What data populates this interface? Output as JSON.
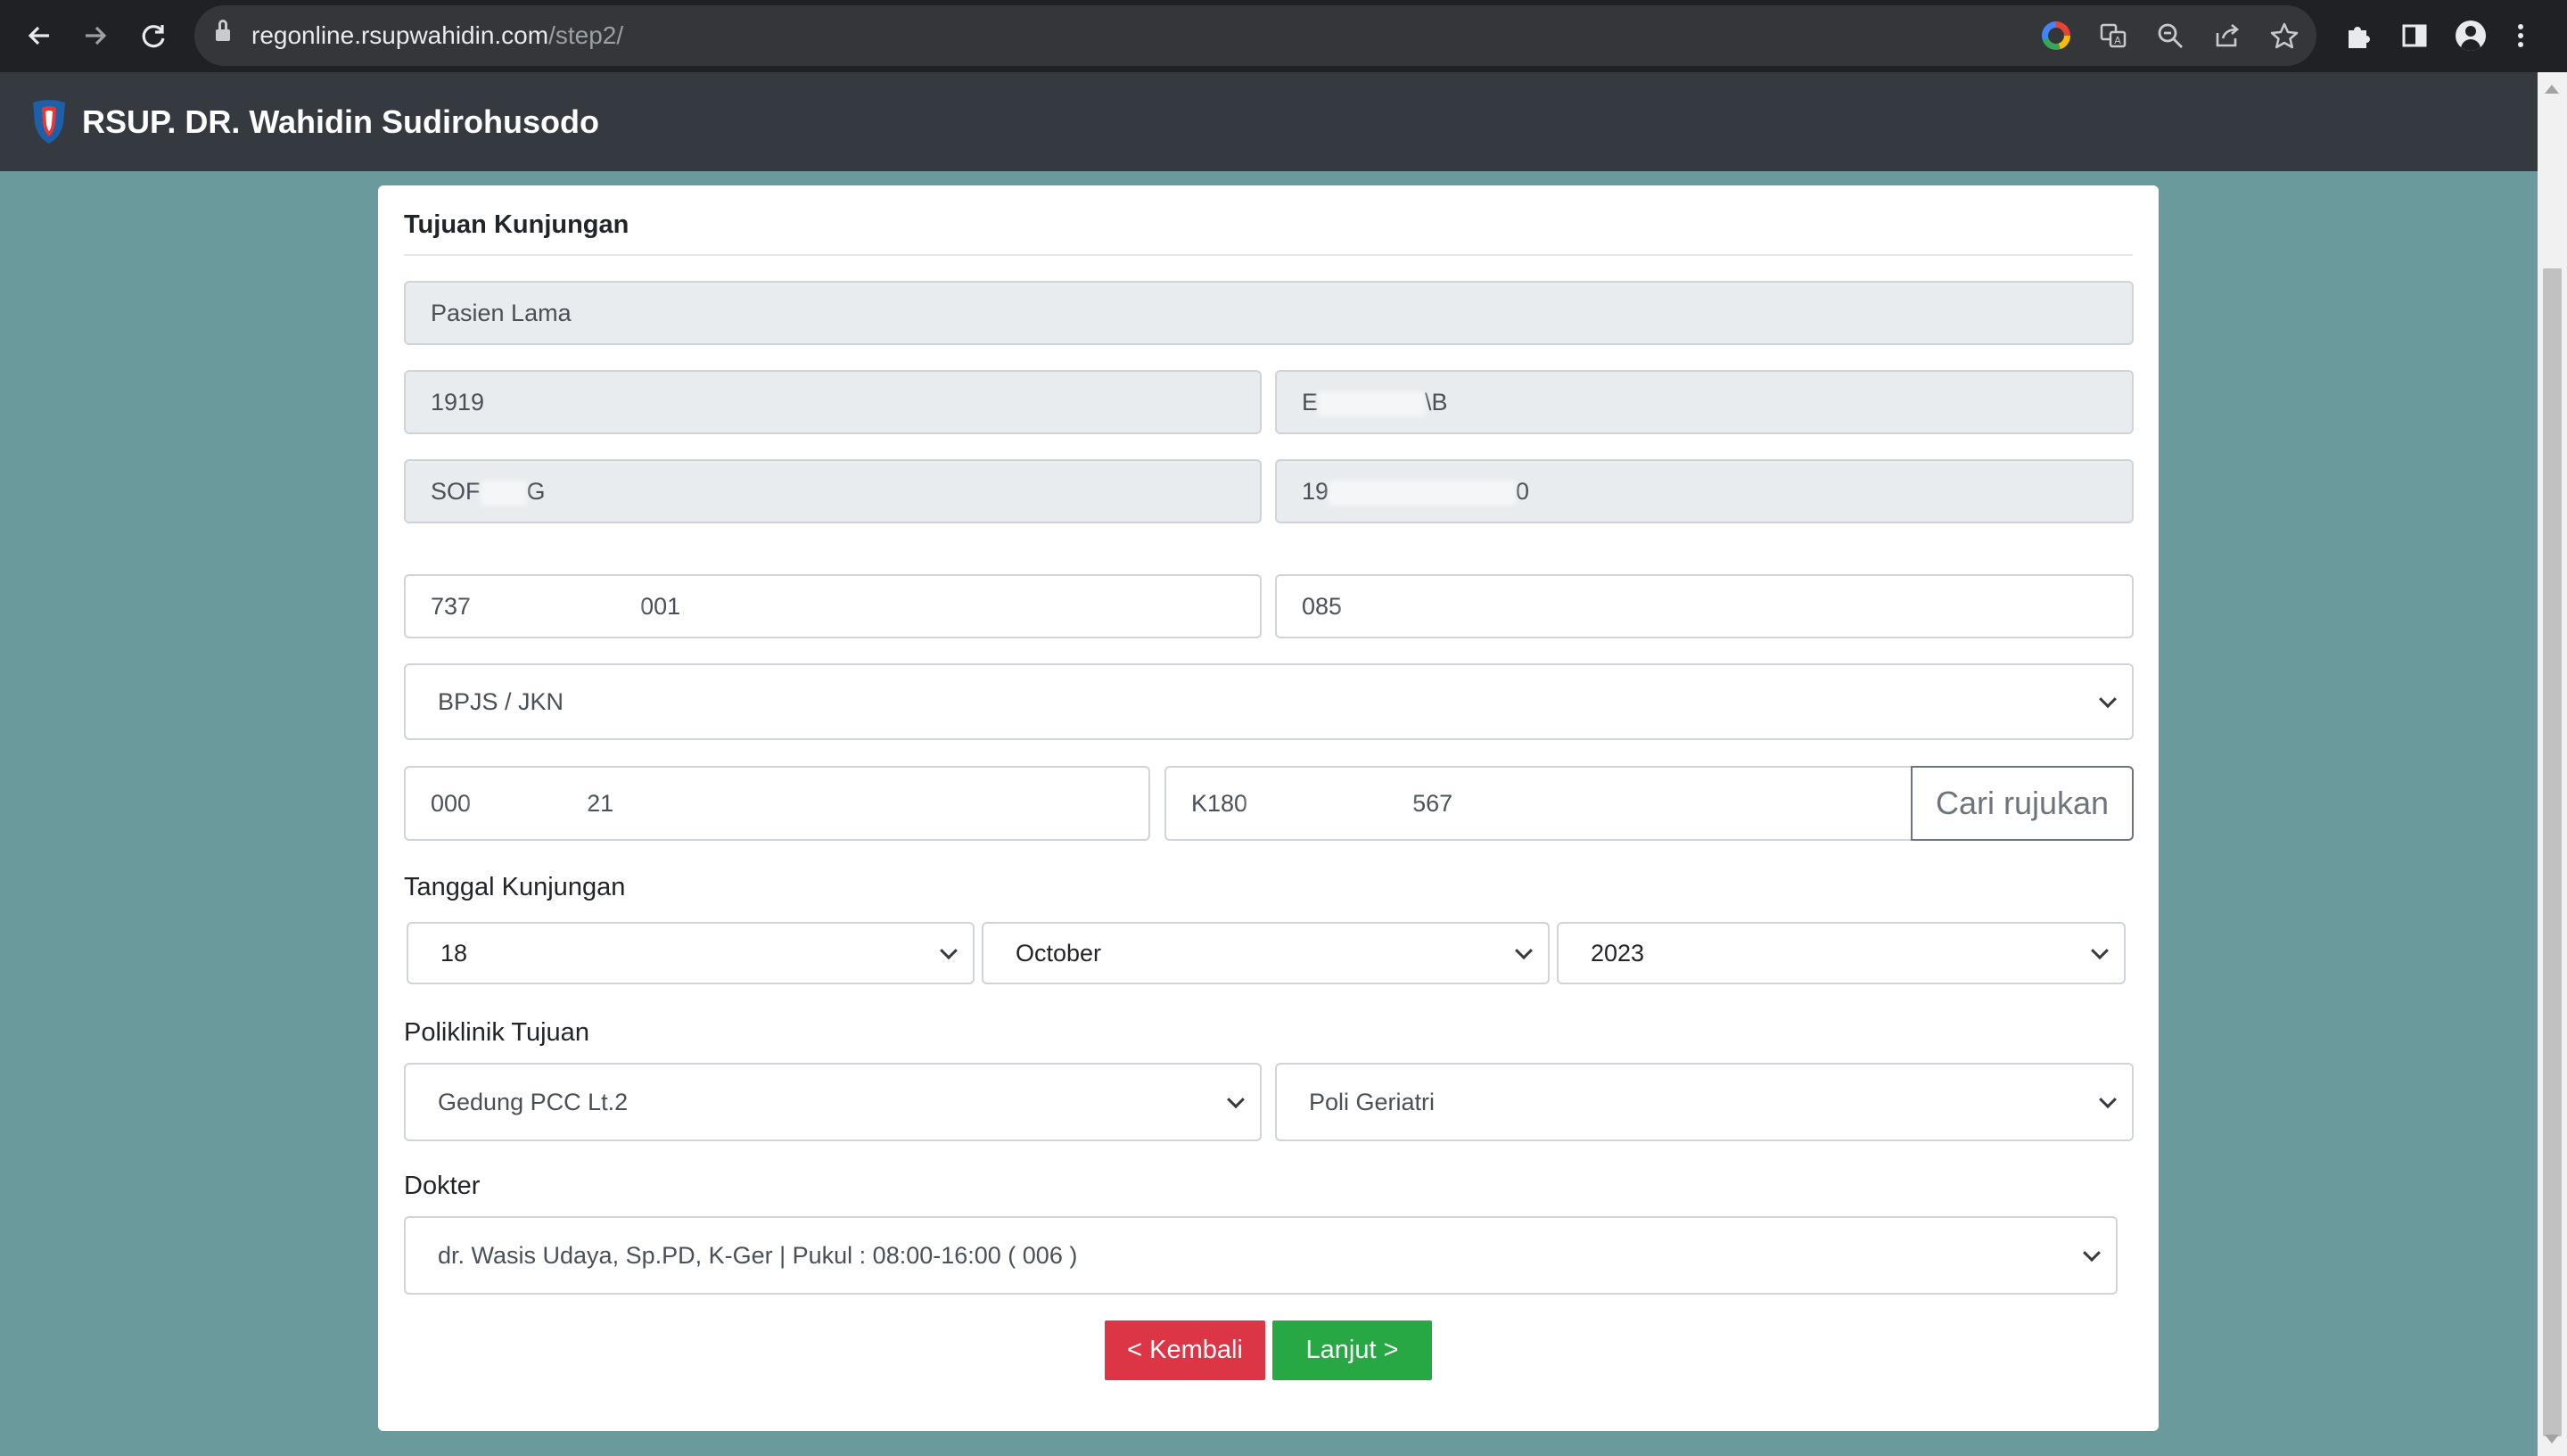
{
  "browser": {
    "url_domain": "regonline.rsupwahidin.com",
    "url_path": "/step2/",
    "icons": [
      "back-arrow-icon",
      "forward-arrow-icon",
      "reload-icon",
      "lock-icon",
      "google-icon",
      "translate-icon",
      "zoom-icon",
      "share-icon",
      "star-icon",
      "extensions-icon",
      "side-panel-icon",
      "profile-icon",
      "kebab-menu-icon"
    ]
  },
  "header": {
    "title": "RSUP. DR. Wahidin Sudirohusodo"
  },
  "form": {
    "section_title": "Tujuan Kunjungan",
    "patient_type": "Pasien Lama",
    "record_number": "1919",
    "name_visible_start": "E",
    "name_visible_end": "\\B",
    "birthplace_visible_start": "SOF",
    "birthplace_visible_end": "G",
    "birthdate_visible_start": "19",
    "birthdate_visible_end": "0",
    "nik_visible_start": "737",
    "nik_visible_end": "001",
    "phone_visible_start": "085",
    "payment_selected": "BPJS / JKN",
    "bpjs_visible_start": "000",
    "bpjs_visible_end": "21",
    "rujukan_visible_start": "K180",
    "rujukan_visible_end": "567",
    "cari_rujukan_label": "Cari rujukan",
    "visit_date_label": "Tanggal Kunjungan",
    "visit_day": "18",
    "visit_month": "October",
    "visit_year": "2023",
    "clinic_label": "Poliklinik Tujuan",
    "building_selected": "Gedung PCC Lt.2",
    "clinic_selected": "Poli Geriatri",
    "doctor_label": "Dokter",
    "doctor_selected": "dr. Wasis Udaya, Sp.PD, K-Ger | Pukul : 08:00-16:00 ( 006 )",
    "back_label": "< Kembali",
    "next_label": "Lanjut >"
  },
  "colors": {
    "page_background": "#6a9a9b",
    "header_background": "#343a40",
    "back_button": "#dc3545",
    "next_button": "#28a745"
  }
}
